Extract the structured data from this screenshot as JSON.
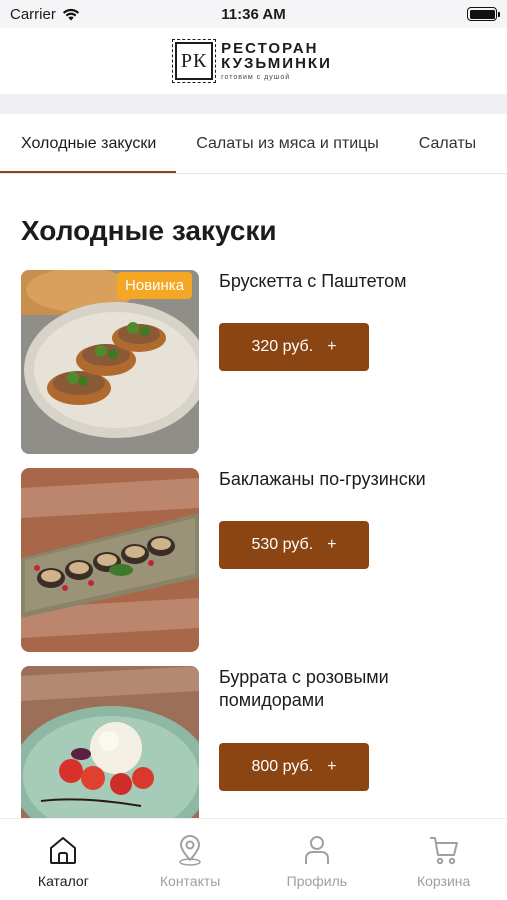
{
  "status_bar": {
    "carrier": "Carrier",
    "time": "11:36 AM",
    "battery_level": 1.0
  },
  "header": {
    "logo_mark": "РК",
    "logo_line1": "РЕСТОРАН",
    "logo_line2": "КУЗЬМИНКИ",
    "logo_tagline": "готовим с душой"
  },
  "tabs": [
    {
      "label": "Холодные закуски",
      "active": true
    },
    {
      "label": "Салаты из мяса и птицы",
      "active": false
    },
    {
      "label": "Салаты",
      "active": false
    }
  ],
  "section": {
    "title": "Холодные закуски"
  },
  "products": [
    {
      "name": "Брускетта с Паштетом",
      "price": "320 руб.",
      "add": "+",
      "badge": "Новинка"
    },
    {
      "name": "Баклажаны по-грузински",
      "price": "530 руб.",
      "add": "+"
    },
    {
      "name": "Буррата с розовыми помидорами",
      "price": "800 руб.",
      "add": "+"
    }
  ],
  "bottom_nav": [
    {
      "label": "Каталог",
      "icon": "home-icon",
      "active": true
    },
    {
      "label": "Контакты",
      "icon": "location-pin-icon",
      "active": false
    },
    {
      "label": "Профиль",
      "icon": "person-icon",
      "active": false
    },
    {
      "label": "Корзина",
      "icon": "cart-icon",
      "active": false
    }
  ],
  "colors": {
    "accent": "#8b4513",
    "badge": "#f5a623",
    "nav_inactive": "#a0a0a0"
  }
}
